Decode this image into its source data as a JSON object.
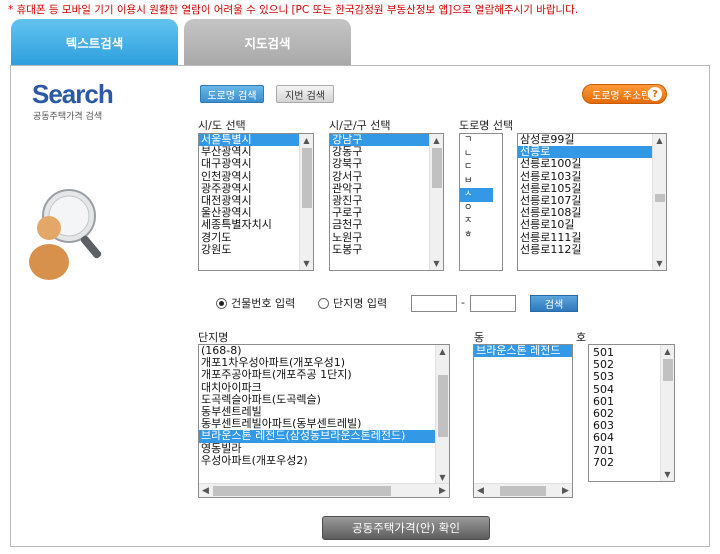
{
  "notice": "* 휴대폰 등 모바일 기기 이용시 원활한 열람이 어려울 수 있으니 [PC 또는 한국감정원 부동산정보 앱]으로 열람해주시기 바랍니다.",
  "tabs": [
    {
      "label": "텍스트검색",
      "active": true
    },
    {
      "label": "지도검색",
      "active": false
    }
  ],
  "logo": {
    "title": "Search",
    "subtitle": "공동주택가격 검색"
  },
  "search_type": {
    "road_label": "도로명 검색",
    "lot_label": "지번 검색"
  },
  "help_button": {
    "label": "도로명 주소란",
    "icon": "question-icon"
  },
  "sido": {
    "label": "시/도 선택",
    "items": [
      "서울특별시",
      "부산광역시",
      "대구광역시",
      "인천광역시",
      "광주광역시",
      "대전광역시",
      "울산광역시",
      "세종특별자치시",
      "경기도",
      "강원도"
    ],
    "selected": 0
  },
  "sigungu": {
    "label": "시/군/구 선택",
    "items": [
      "강남구",
      "강동구",
      "강북구",
      "강서구",
      "관악구",
      "광진구",
      "구로구",
      "금천구",
      "노원구",
      "도봉구"
    ],
    "selected": 0
  },
  "road": {
    "label": "도로명 선택",
    "initials": [
      "ㄱ",
      "ㄴ",
      "ㄷ",
      "ㅂ",
      "ㅅ",
      "ㅇ",
      "ㅈ",
      "ㅎ"
    ],
    "initial_selected": 4,
    "items": [
      "삼성로99길",
      "선릉로",
      "선릉로100길",
      "선릉로103길",
      "선릉로105길",
      "선릉로107길",
      "선릉로108길",
      "선릉로10길",
      "선릉로111길",
      "선릉로112길"
    ],
    "selected": 1
  },
  "input_mode": {
    "building_label": "건물번호 입력",
    "complex_label": "단지명 입력",
    "selected": "building",
    "separator": "-",
    "search_label": "검색",
    "value1": "",
    "value2": ""
  },
  "complex": {
    "label": "단지명",
    "items": [
      "(168-8)",
      "개포1차우성아파트(개포우성1)",
      "개포주공아파트(개포주공 1단지)",
      "대치아이파크",
      "도곡렉슬아파트(도곡렉슬)",
      "동부센트레빌",
      "동부센트레빌아파트(동부센트레빌)",
      "브라운스톤 레전드(삼성동브라운스톤레전드)",
      "영동빌라",
      "우성아파트(개포우성2)"
    ],
    "selected": 7
  },
  "dong": {
    "label": "동",
    "items": [
      "브라운스톤 레전드"
    ],
    "selected": 0
  },
  "ho": {
    "label": "호",
    "items": [
      "501",
      "502",
      "503",
      "504",
      "601",
      "602",
      "603",
      "604",
      "701",
      "702"
    ]
  },
  "confirm_label": "공동주택가격(안) 확인"
}
